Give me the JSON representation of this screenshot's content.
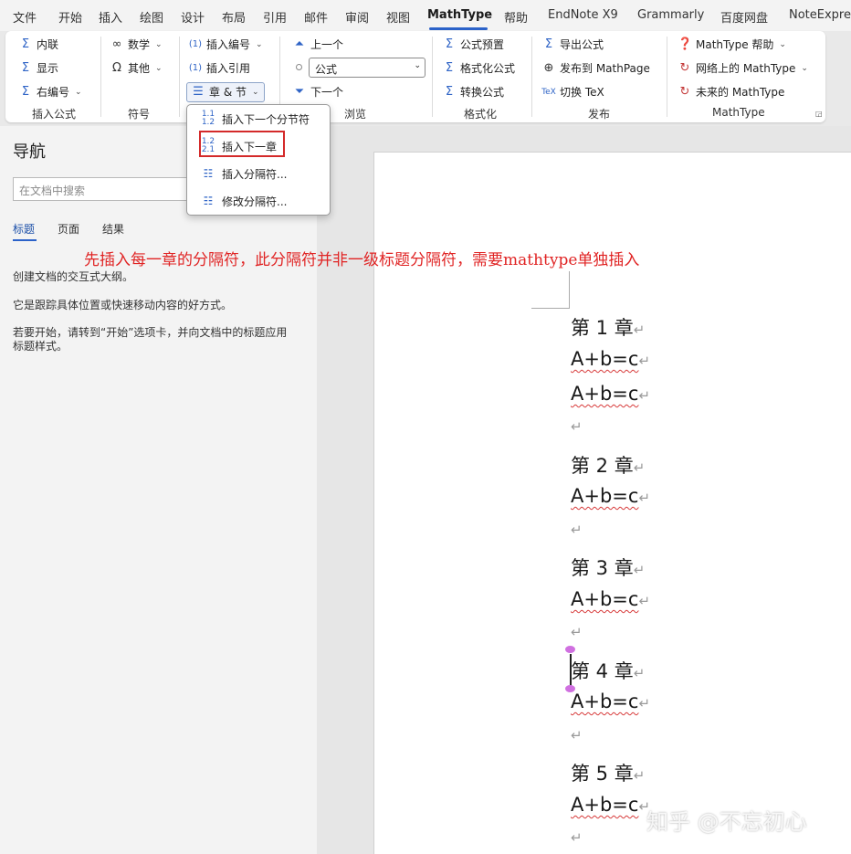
{
  "ribbon_tabs": [
    "文件",
    "开始",
    "插入",
    "绘图",
    "设计",
    "布局",
    "引用",
    "邮件",
    "审阅",
    "视图",
    "MathType",
    "帮助",
    "EndNote X9",
    "Grammarly",
    "百度网盘",
    "NoteExpress"
  ],
  "active_tab": "MathType",
  "groups": {
    "insert_equation": {
      "label": "插入公式",
      "items": [
        "内联",
        "显示",
        "右编号"
      ]
    },
    "symbols": {
      "label": "符号",
      "items": [
        "数学",
        "其他"
      ]
    },
    "numbers": {
      "items": [
        "插入编号",
        "插入引用",
        "章 & 节"
      ]
    },
    "browse": {
      "label": "浏览",
      "items": [
        "上一个",
        "下一个"
      ],
      "select_value": "公式"
    },
    "format": {
      "label": "格式化",
      "items": [
        "公式预置",
        "格式化公式",
        "转换公式"
      ]
    },
    "publish": {
      "label": "发布",
      "items": [
        "导出公式",
        "发布到 MathPage",
        "切换 TeX"
      ]
    },
    "mathtype": {
      "label": "MathType",
      "items": [
        "MathType 帮助",
        "网络上的 MathType",
        "未来的 MathType"
      ]
    }
  },
  "dropdown": {
    "items": [
      "插入下一个分节符",
      "插入下一章",
      "插入分隔符...",
      "修改分隔符..."
    ],
    "highlighted": "插入下一章"
  },
  "nav": {
    "title": "导航",
    "search_placeholder": "在文档中搜索",
    "tabs": [
      "标题",
      "页面",
      "结果"
    ],
    "active_tab": "标题",
    "text1": "创建文档的交互式大纲。",
    "text2": "它是跟踪具体位置或快速移动内容的好方式。",
    "text3": "若要开始，请转到“开始”选项卡，并向文档中的标题应用标题样式。"
  },
  "annotation": "先插入每一章的分隔符，此分隔符并非一级标题分隔符，需要mathtype单独插入",
  "document": {
    "chapters": [
      "第 1 章",
      "第 2 章",
      "第 3 章",
      "第 4 章",
      "第 5 章"
    ],
    "equation": "A+b=c",
    "paragraph_mark": "↵"
  },
  "watermark": "知乎 @不忘初心",
  "colors": {
    "accent": "#2b62c9",
    "annotation": "#e02424",
    "highlight_box": "#d42a2a"
  }
}
